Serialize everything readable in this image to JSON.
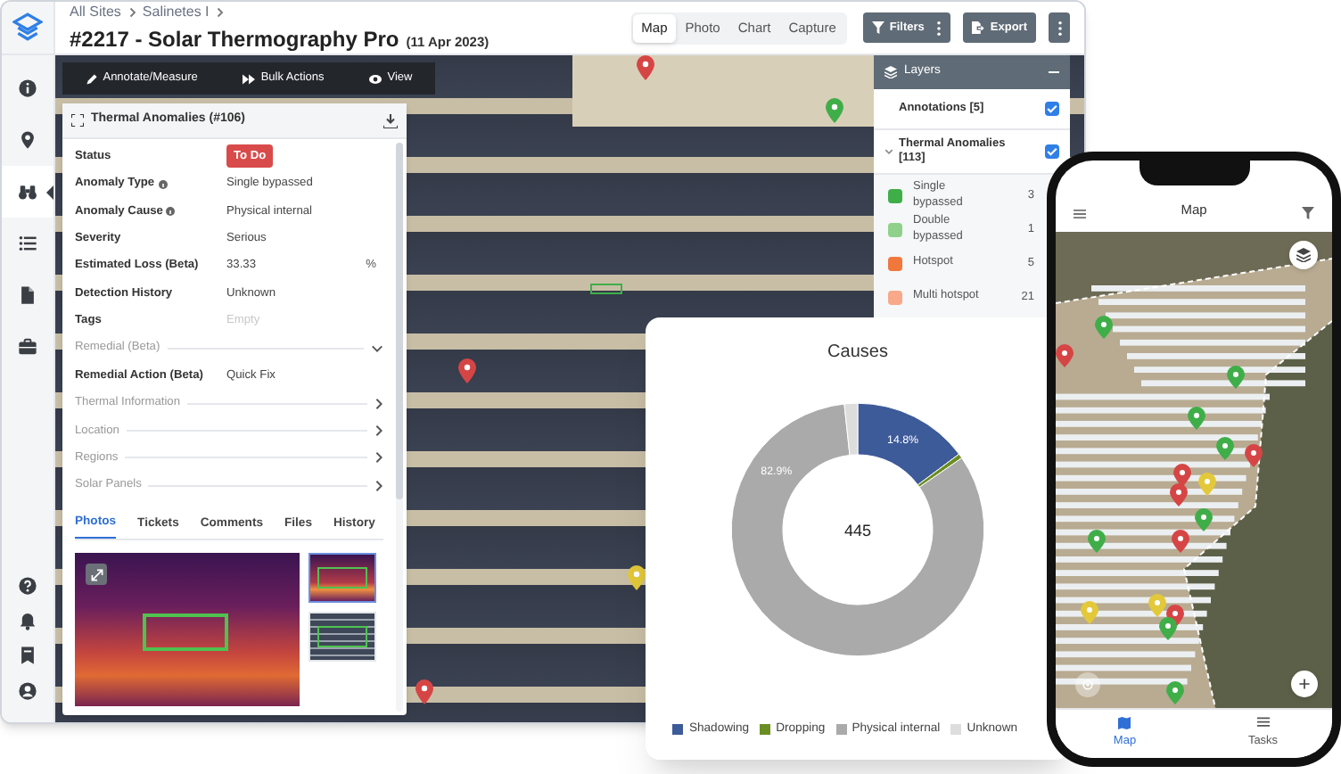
{
  "rail": [
    {
      "selected": false
    },
    {
      "selected": false
    },
    {
      "selected": true
    },
    {
      "selected": false
    },
    {
      "selected": false
    },
    {
      "selected": false
    },
    {
      "selected": false
    },
    {
      "selected": false
    },
    {
      "selected": false
    },
    {
      "selected": false
    }
  ],
  "header": {
    "breadcrumb": [
      "All Sites",
      "Salinetes I"
    ],
    "title": "#2217 - Solar Thermography Pro",
    "date": "(11 Apr 2023)",
    "view_tabs": [
      {
        "label": "Map",
        "selected": true
      },
      {
        "label": "Photo",
        "selected": false
      },
      {
        "label": "Chart",
        "selected": false
      },
      {
        "label": "Capture",
        "selected": false
      }
    ],
    "filters": "Filters",
    "export": "Export"
  },
  "map_toolbar": [
    "Annotate/Measure",
    "Bulk Actions",
    "View"
  ],
  "panel": {
    "title": "Thermal Anomalies (#106)",
    "fields": [
      {
        "kind": "status",
        "label": "Status",
        "value": "To Do"
      },
      {
        "kind": "info",
        "label": "Anomaly Type",
        "value": "Single bypassed"
      },
      {
        "kind": "info",
        "label": "Anomaly Cause",
        "value": "Physical internal"
      },
      {
        "kind": "field",
        "label": "Severity",
        "value": "Serious"
      },
      {
        "kind": "unit",
        "label": "Estimated Loss (Beta)",
        "value": "33.33",
        "unit": "%"
      },
      {
        "kind": "field",
        "label": "Detection History",
        "value": "Unknown"
      },
      {
        "kind": "empty",
        "label": "Tags",
        "placeholder": "Empty"
      },
      {
        "kind": "section",
        "label": "Remedial (Beta)",
        "expanded": true
      },
      {
        "kind": "field",
        "label": "Remedial Action (Beta)",
        "value": "Quick Fix"
      },
      {
        "kind": "section",
        "label": "Thermal Information",
        "expanded": false
      },
      {
        "kind": "section",
        "label": "Location",
        "expanded": false
      },
      {
        "kind": "section",
        "label": "Regions",
        "expanded": false
      },
      {
        "kind": "section",
        "label": "Solar Panels",
        "expanded": false
      }
    ],
    "tabs": [
      {
        "label": "Photos",
        "selected": true
      },
      {
        "label": "Tickets",
        "selected": false
      },
      {
        "label": "Comments",
        "selected": false
      },
      {
        "label": "Files",
        "selected": false
      },
      {
        "label": "History",
        "selected": false
      }
    ],
    "thumbnails": [
      {
        "selected": true
      },
      {
        "selected": false
      }
    ]
  },
  "layers": {
    "title": "Layers",
    "groups": [
      {
        "label": "Annotations [5]",
        "checked": true
      },
      {
        "label": "Thermal Anomalies [113]",
        "checked": true,
        "expanded": true
      }
    ],
    "items": [
      {
        "name": "Single bypassed",
        "count": "3",
        "color": "#3fae49"
      },
      {
        "name": "Double bypassed",
        "count": "1",
        "color": "#8fd18a"
      },
      {
        "name": "Hotspot",
        "count": "5",
        "color": "#f0783c"
      },
      {
        "name": "Multi hotspot",
        "count": "21",
        "color": "#f8a98a"
      }
    ]
  },
  "causes_chart": {
    "total": "445",
    "legend": [
      {
        "color": "#3d5a99"
      },
      {
        "color": "#6b8e23"
      },
      {
        "color": "#aaaaaa"
      },
      {
        "color": "#dddddd"
      }
    ],
    "chart_data": {
      "type": "donut",
      "title": "Causes",
      "categories": [
        "Shadowing",
        "Dropping",
        "Physical internal",
        "Unknown"
      ],
      "series": [
        {
          "values": [
            14.8,
            0.6,
            82.9,
            1.7
          ]
        }
      ],
      "value_labels": [
        "14.8%",
        null,
        "82.9%",
        null
      ]
    }
  },
  "phone": {
    "title": "Map",
    "nav": [
      {
        "label": "Map",
        "selected": true
      },
      {
        "label": "Tasks",
        "selected": false
      }
    ]
  }
}
